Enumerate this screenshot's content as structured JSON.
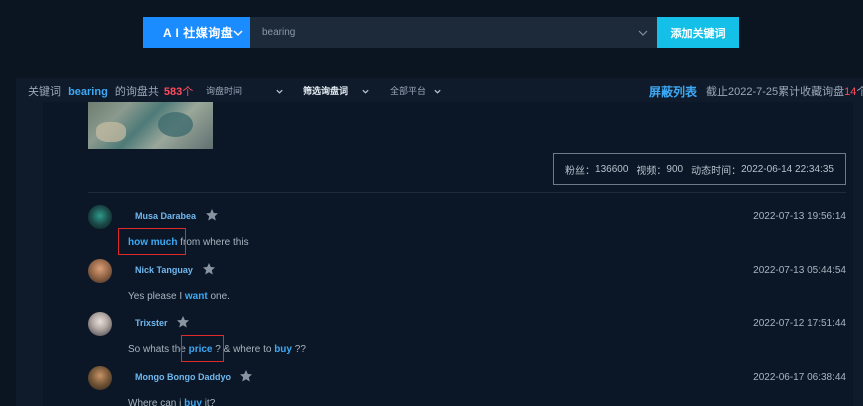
{
  "search": {
    "platform_label": "A I 社媒询盘",
    "keyword_value": "bearing",
    "add_button": "添加关键词"
  },
  "filters": {
    "prefix": "关键词",
    "keyword": "bearing",
    "middle": "的询盘共",
    "count": "583",
    "unit": "个",
    "time_filter": "询盘时间",
    "word_filter": "筛选询盘词",
    "platform_filter": "全部平台",
    "block_list": "屏蔽列表",
    "summary_prefix": "截止2022-7-25累计收藏询盘",
    "summary_count": "14",
    "summary_unit": "个"
  },
  "post_stats": {
    "fans_label": "粉丝：",
    "fans": "136600",
    "videos_label": "视频：",
    "videos": "900",
    "time_label": "动态时间：",
    "time": "2022-06-14 22:34:35"
  },
  "comments": [
    {
      "user": "Musa Darabea",
      "time": "2022-07-13 19:56:14",
      "kw": "how much",
      "rest": " from where this"
    },
    {
      "user": "Nick Tanguay",
      "time": "2022-07-13 05:44:54",
      "pre": "Yes please I ",
      "kw": "want",
      "rest": " one."
    },
    {
      "user": "Trixster",
      "time": "2022-07-12 17:51:44",
      "pre": "So whats the ",
      "kw": "price",
      "mid": " ? & where to ",
      "kw2": "buy",
      "rest": " ??"
    },
    {
      "user": "Mongo Bongo Daddyo",
      "time": "2022-06-17 06:38:44",
      "pre": "Where can i ",
      "kw": "buy",
      "rest": " it?"
    }
  ],
  "colors": {
    "accent": "#1a8cff",
    "add_button": "#14c0e8",
    "keyword_highlight": "#3da9f5",
    "count_red": "#ff4b5c",
    "annotation_box": "#e02a2a"
  }
}
